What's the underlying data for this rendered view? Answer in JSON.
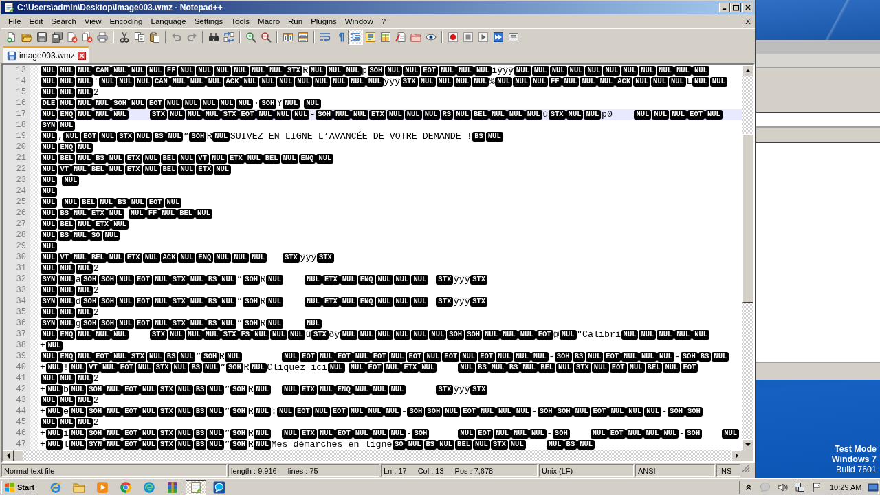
{
  "window": {
    "title": "C:\\Users\\admin\\Desktop\\image003.wmz - Notepad++"
  },
  "menu_bar": {
    "items": [
      "File",
      "Edit",
      "Search",
      "View",
      "Encoding",
      "Language",
      "Settings",
      "Tools",
      "Macro",
      "Run",
      "Plugins",
      "Window",
      "?"
    ],
    "close_label": "X"
  },
  "toolbar": {
    "groups": [
      [
        {
          "pressed": false
        },
        {
          "pressed": false
        },
        {
          "pressed": false
        },
        {
          "pressed": false
        },
        {
          "pressed": false
        },
        {
          "pressed": false
        },
        {
          "pressed": false
        }
      ],
      [
        {
          "pressed": false
        },
        {
          "pressed": false
        },
        {
          "pressed": false
        }
      ],
      [
        {
          "pressed": false
        },
        {
          "pressed": false
        }
      ],
      [
        {
          "pressed": false
        },
        {
          "pressed": false
        }
      ],
      [
        {
          "pressed": false
        },
        {
          "pressed": false
        }
      ],
      [
        {
          "pressed": false
        },
        {
          "pressed": false
        }
      ],
      [
        {
          "pressed": false
        },
        {
          "pressed": false
        },
        {
          "pressed": true
        },
        {
          "pressed": false
        },
        {
          "pressed": false
        },
        {
          "pressed": false
        },
        {
          "pressed": false
        },
        {
          "pressed": false
        }
      ],
      [
        {
          "pressed": false
        },
        {
          "pressed": false
        },
        {
          "pressed": false
        },
        {
          "pressed": false
        },
        {
          "pressed": false
        }
      ]
    ]
  },
  "tabs": [
    {
      "label": "image003.wmz",
      "selected": true,
      "saved": true
    }
  ],
  "editor": {
    "lines": [
      {
        "number": "13",
        "current": false,
        "segments": [
          {
            "kind": "ctrl",
            "codes": [
              "NUL",
              "NUL",
              "NUL",
              "CAN",
              "NUL",
              "NUL",
              "NUL",
              "FF",
              "NUL",
              "NUL",
              "NUL",
              "NUL",
              "NUL",
              "NUL",
              "STX"
            ]
          },
          {
            "kind": "text",
            "text": "R"
          },
          {
            "kind": "ctrl",
            "codes": [
              "NUL",
              "NUL",
              "NUL"
            ]
          },
          {
            "kind": "text",
            "text": "p"
          },
          {
            "kind": "ctrl",
            "codes": [
              "SOH",
              "NUL",
              "NUL",
              "EOT",
              "NUL",
              "NUL",
              "NUL"
            ]
          },
          {
            "kind": "text",
            "text": "iÿÿÿ"
          },
          {
            "kind": "ctrl",
            "codes": [
              "NUL",
              "NUL",
              "NUL",
              "NUL",
              "NUL",
              "NUL",
              "NUL",
              "NUL",
              "NUL",
              "NUL",
              "NUL"
            ]
          }
        ]
      },
      {
        "number": "14",
        "current": false,
        "segments": [
          {
            "kind": "ctrl",
            "codes": [
              "NUL",
              "NUL",
              "NUL"
            ]
          },
          {
            "kind": "text",
            "text": "'"
          },
          {
            "kind": "ctrl",
            "codes": [
              "NUL",
              "NUL",
              "NUL",
              "CAN",
              "NUL",
              "NUL",
              "NUL",
              "ACK",
              "NUL",
              "NUL",
              "NUL",
              "NUL",
              "NUL",
              "NUL",
              "NUL",
              "NUL"
            ]
          },
          {
            "kind": "text",
            "text": "ÿÿÿ"
          },
          {
            "kind": "ctrl",
            "codes": [
              "STX",
              "NUL",
              "NUL",
              "NUL",
              "NUL"
            ]
          },
          {
            "kind": "text",
            "text": "%"
          },
          {
            "kind": "ctrl",
            "codes": [
              "NUL",
              "NUL",
              "NUL",
              "FF",
              "NUL",
              "NUL",
              "NUL",
              "ACK",
              "NUL",
              "NUL",
              "NUL"
            ]
          },
          {
            "kind": "text",
            "text": "L"
          },
          {
            "kind": "ctrl",
            "codes": [
              "NUL",
              "NUL"
            ]
          }
        ]
      },
      {
        "number": "15",
        "current": false,
        "segments": [
          {
            "kind": "ctrl",
            "codes": [
              "NUL",
              "NUL",
              "NUL"
            ]
          },
          {
            "kind": "text",
            "text": "2"
          }
        ]
      },
      {
        "number": "16",
        "current": false,
        "segments": [
          {
            "kind": "ctrl",
            "codes": [
              "DLE",
              "NUL",
              "NUL",
              "NUL",
              "SOH",
              "NUL",
              "EOT",
              "NUL",
              "NUL",
              "NUL",
              "NUL",
              "NUL"
            ]
          },
          {
            "kind": "text",
            "text": "·"
          },
          {
            "kind": "ctrl",
            "codes": [
              "SOH"
            ]
          },
          {
            "kind": "text",
            "text": "Y"
          },
          {
            "kind": "ctrl",
            "codes": [
              "NUL"
            ]
          },
          {
            "kind": "tab"
          },
          {
            "kind": "ctrl",
            "codes": [
              "NUL"
            ]
          }
        ]
      },
      {
        "number": "17",
        "current": true,
        "segments": [
          {
            "kind": "ctrl",
            "codes": [
              "NUL",
              "ENQ",
              "NUL",
              "NUL",
              "NUL"
            ]
          },
          {
            "kind": "tab"
          },
          {
            "kind": "ctrl",
            "codes": [
              "STX",
              "NUL",
              "NUL",
              "NUL"
            ]
          },
          {
            "kind": "caret"
          },
          {
            "kind": "ctrl",
            "codes": [
              "STX",
              "EOT",
              "NUL",
              "NUL",
              "NUL"
            ]
          },
          {
            "kind": "text",
            "text": "-"
          },
          {
            "kind": "ctrl",
            "codes": [
              "SOH",
              "NUL",
              "NUL",
              "ETX",
              "NUL",
              "NUL",
              "NUL",
              "RS",
              "NUL",
              "BEL",
              "NUL",
              "NUL",
              "NUL"
            ]
          },
          {
            "kind": "text",
            "text": "ù"
          },
          {
            "kind": "ctrl",
            "codes": [
              "STX",
              "NUL",
              "NUL"
            ]
          },
          {
            "kind": "text",
            "text": "p0"
          },
          {
            "kind": "tab"
          },
          {
            "kind": "ctrl",
            "codes": [
              "NUL",
              "NUL",
              "NUL",
              "EOT",
              "NUL"
            ]
          }
        ]
      },
      {
        "number": "18",
        "current": false,
        "segments": [
          {
            "kind": "ctrl",
            "codes": [
              "SYN",
              "NUL"
            ]
          }
        ]
      },
      {
        "number": "19",
        "current": false,
        "segments": [
          {
            "kind": "ctrl",
            "codes": [
              "NUL"
            ]
          },
          {
            "kind": "text",
            "text": ","
          },
          {
            "kind": "ctrl",
            "codes": [
              "NUL",
              "EOT",
              "NUL",
              "STX",
              "NUL",
              "BS",
              "NUL"
            ]
          },
          {
            "kind": "text",
            "text": "”"
          },
          {
            "kind": "ctrl",
            "codes": [
              "SOH"
            ]
          },
          {
            "kind": "text",
            "text": "R"
          },
          {
            "kind": "ctrl",
            "codes": [
              "NUL"
            ]
          },
          {
            "kind": "text",
            "text": "SUIVEZ EN LIGNE L’AVANCÉE DE VOTRE DEMANDE !"
          },
          {
            "kind": "ctrl",
            "codes": [
              "BS",
              "NUL"
            ]
          }
        ]
      },
      {
        "number": "20",
        "current": false,
        "segments": [
          {
            "kind": "ctrl",
            "codes": [
              "NUL",
              "ENQ",
              "NUL"
            ]
          }
        ]
      },
      {
        "number": "21",
        "current": false,
        "segments": [
          {
            "kind": "ctrl",
            "codes": [
              "NUL",
              "BEL",
              "NUL",
              "BS",
              "NUL",
              "ETX",
              "NUL",
              "BEL",
              "NUL",
              "VT",
              "NUL",
              "ETX",
              "NUL",
              "BEL",
              "NUL",
              "ENQ",
              "NUL"
            ]
          }
        ]
      },
      {
        "number": "22",
        "current": false,
        "segments": [
          {
            "kind": "ctrl",
            "codes": [
              "NUL",
              "VT",
              "NUL",
              "BEL",
              "NUL",
              "ETX",
              "NUL",
              "BEL",
              "NUL",
              "ETX",
              "NUL"
            ]
          }
        ]
      },
      {
        "number": "23",
        "current": false,
        "segments": [
          {
            "kind": "ctrl",
            "codes": [
              "NUL"
            ]
          },
          {
            "kind": "tab"
          },
          {
            "kind": "ctrl",
            "codes": [
              "NUL"
            ]
          }
        ]
      },
      {
        "number": "24",
        "current": false,
        "segments": [
          {
            "kind": "ctrl",
            "codes": [
              "NUL"
            ]
          }
        ]
      },
      {
        "number": "25",
        "current": false,
        "segments": [
          {
            "kind": "ctrl",
            "codes": [
              "NUL"
            ]
          },
          {
            "kind": "tab"
          },
          {
            "kind": "ctrl",
            "codes": [
              "NUL",
              "BEL",
              "NUL",
              "BS",
              "NUL",
              "EOT",
              "NUL"
            ]
          }
        ]
      },
      {
        "number": "26",
        "current": false,
        "segments": [
          {
            "kind": "ctrl",
            "codes": [
              "NUL",
              "BS",
              "NUL",
              "ETX",
              "NUL"
            ]
          },
          {
            "kind": "tab"
          },
          {
            "kind": "ctrl",
            "codes": [
              "NUL",
              "FF",
              "NUL",
              "BEL",
              "NUL"
            ]
          }
        ]
      },
      {
        "number": "27",
        "current": false,
        "segments": [
          {
            "kind": "ctrl",
            "codes": [
              "NUL",
              "BEL",
              "NUL",
              "ETX",
              "NUL"
            ]
          }
        ]
      },
      {
        "number": "28",
        "current": false,
        "segments": [
          {
            "kind": "ctrl",
            "codes": [
              "NUL",
              "BS",
              "NUL",
              "SO",
              "NUL"
            ]
          }
        ]
      },
      {
        "number": "29",
        "current": false,
        "segments": [
          {
            "kind": "ctrl",
            "codes": [
              "NUL"
            ]
          }
        ]
      },
      {
        "number": "30",
        "current": false,
        "segments": [
          {
            "kind": "ctrl",
            "codes": [
              "NUL",
              "VT",
              "NUL",
              "BEL",
              "NUL",
              "ETX",
              "NUL",
              "ACK",
              "NUL",
              "ENQ",
              "NUL",
              "NUL",
              "NUL"
            ]
          },
          {
            "kind": "tab"
          },
          {
            "kind": "ctrl",
            "codes": [
              "STX"
            ]
          },
          {
            "kind": "text",
            "text": "ÿÿÿ"
          },
          {
            "kind": "ctrl",
            "codes": [
              "STX"
            ]
          }
        ]
      },
      {
        "number": "31",
        "current": false,
        "segments": [
          {
            "kind": "ctrl",
            "codes": [
              "NUL",
              "NUL",
              "NUL"
            ]
          },
          {
            "kind": "text",
            "text": "2"
          }
        ]
      },
      {
        "number": "32",
        "current": false,
        "segments": [
          {
            "kind": "ctrl",
            "codes": [
              "SYN",
              "NUL"
            ]
          },
          {
            "kind": "text",
            "text": "a"
          },
          {
            "kind": "ctrl",
            "codes": [
              "SOH",
              "SOH",
              "NUL",
              "EOT",
              "NUL",
              "STX",
              "NUL",
              "BS",
              "NUL"
            ]
          },
          {
            "kind": "text",
            "text": "”"
          },
          {
            "kind": "ctrl",
            "codes": [
              "SOH"
            ]
          },
          {
            "kind": "text",
            "text": "R"
          },
          {
            "kind": "ctrl",
            "codes": [
              "NUL"
            ]
          },
          {
            "kind": "tab"
          },
          {
            "kind": "ctrl",
            "codes": [
              "NUL",
              "ETX",
              "NUL",
              "ENQ",
              "NUL",
              "NUL",
              "NUL"
            ]
          },
          {
            "kind": "tab"
          },
          {
            "kind": "ctrl",
            "codes": [
              "STX"
            ]
          },
          {
            "kind": "text",
            "text": "ÿÿÿ"
          },
          {
            "kind": "ctrl",
            "codes": [
              "STX"
            ]
          }
        ]
      },
      {
        "number": "33",
        "current": false,
        "segments": [
          {
            "kind": "ctrl",
            "codes": [
              "NUL",
              "NUL",
              "NUL"
            ]
          },
          {
            "kind": "text",
            "text": "2"
          }
        ]
      },
      {
        "number": "34",
        "current": false,
        "segments": [
          {
            "kind": "ctrl",
            "codes": [
              "SYN",
              "NUL"
            ]
          },
          {
            "kind": "text",
            "text": "d"
          },
          {
            "kind": "ctrl",
            "codes": [
              "SOH",
              "SOH",
              "NUL",
              "EOT",
              "NUL",
              "STX",
              "NUL",
              "BS",
              "NUL"
            ]
          },
          {
            "kind": "text",
            "text": "”"
          },
          {
            "kind": "ctrl",
            "codes": [
              "SOH"
            ]
          },
          {
            "kind": "text",
            "text": "R"
          },
          {
            "kind": "ctrl",
            "codes": [
              "NUL"
            ]
          },
          {
            "kind": "tab"
          },
          {
            "kind": "ctrl",
            "codes": [
              "NUL",
              "ETX",
              "NUL",
              "ENQ",
              "NUL",
              "NUL",
              "NUL"
            ]
          },
          {
            "kind": "tab"
          },
          {
            "kind": "ctrl",
            "codes": [
              "STX"
            ]
          },
          {
            "kind": "text",
            "text": "ÿÿÿ"
          },
          {
            "kind": "ctrl",
            "codes": [
              "STX"
            ]
          }
        ]
      },
      {
        "number": "35",
        "current": false,
        "segments": [
          {
            "kind": "ctrl",
            "codes": [
              "NUL",
              "NUL",
              "NUL"
            ]
          },
          {
            "kind": "text",
            "text": "2"
          }
        ]
      },
      {
        "number": "36",
        "current": false,
        "segments": [
          {
            "kind": "ctrl",
            "codes": [
              "SYN",
              "NUL"
            ]
          },
          {
            "kind": "text",
            "text": "g"
          },
          {
            "kind": "ctrl",
            "codes": [
              "SOH",
              "SOH",
              "NUL",
              "EOT",
              "NUL",
              "STX",
              "NUL",
              "BS",
              "NUL"
            ]
          },
          {
            "kind": "text",
            "text": "”"
          },
          {
            "kind": "ctrl",
            "codes": [
              "SOH"
            ]
          },
          {
            "kind": "text",
            "text": "R"
          },
          {
            "kind": "ctrl",
            "codes": [
              "NUL"
            ]
          },
          {
            "kind": "tab"
          },
          {
            "kind": "ctrl",
            "codes": [
              "NUL"
            ]
          }
        ]
      },
      {
        "number": "37",
        "current": false,
        "segments": [
          {
            "kind": "ctrl",
            "codes": [
              "NUL",
              "ENQ",
              "NUL",
              "NUL",
              "NUL"
            ]
          },
          {
            "kind": "tab"
          },
          {
            "kind": "ctrl",
            "codes": [
              "STX",
              "NUL",
              "NUL",
              "NUL",
              "STX",
              "FS",
              "NUL",
              "NUL",
              "NUL"
            ]
          },
          {
            "kind": "text",
            "text": "û"
          },
          {
            "kind": "ctrl",
            "codes": [
              "STX"
            ]
          },
          {
            "kind": "text",
            "text": "ðÿ"
          },
          {
            "kind": "ctrl",
            "codes": [
              "NUL",
              "NUL",
              "NUL",
              "NUL",
              "NUL",
              "NUL",
              "SOH",
              "SOH",
              "NUL",
              "NUL",
              "NUL",
              "EOT"
            ]
          },
          {
            "kind": "text",
            "text": "@"
          },
          {
            "kind": "ctrl",
            "codes": [
              "NUL"
            ]
          },
          {
            "kind": "text",
            "text": "\"Calibri"
          },
          {
            "kind": "ctrl",
            "codes": [
              "NUL",
              "NUL",
              "NUL",
              "NUL",
              "NUL"
            ]
          }
        ]
      },
      {
        "number": "38",
        "current": false,
        "segments": [
          {
            "kind": "text",
            "text": "+"
          },
          {
            "kind": "ctrl",
            "codes": [
              "NUL"
            ]
          }
        ]
      },
      {
        "number": "39",
        "current": false,
        "segments": [
          {
            "kind": "ctrl",
            "codes": [
              "NUL",
              "ENQ",
              "NUL",
              "EOT",
              "NUL",
              "STX",
              "NUL",
              "BS",
              "NUL"
            ]
          },
          {
            "kind": "text",
            "text": "”"
          },
          {
            "kind": "ctrl",
            "codes": [
              "SOH"
            ]
          },
          {
            "kind": "text",
            "text": "R"
          },
          {
            "kind": "ctrl",
            "codes": [
              "NUL"
            ]
          },
          {
            "kind": "tab"
          },
          {
            "kind": "tab"
          },
          {
            "kind": "ctrl",
            "codes": [
              "NUL",
              "EOT",
              "NUL",
              "EOT",
              "NUL",
              "EOT",
              "NUL",
              "EOT",
              "NUL",
              "EOT",
              "NUL",
              "EOT",
              "NUL",
              "NUL",
              "NUL"
            ]
          },
          {
            "kind": "text",
            "text": "-"
          },
          {
            "kind": "ctrl",
            "codes": [
              "SOH",
              "BS",
              "NUL",
              "EOT",
              "NUL",
              "NUL",
              "NUL"
            ]
          },
          {
            "kind": "text",
            "text": "-"
          },
          {
            "kind": "ctrl",
            "codes": [
              "SOH",
              "BS",
              "NUL"
            ]
          }
        ]
      },
      {
        "number": "40",
        "current": false,
        "segments": [
          {
            "kind": "text",
            "text": "+"
          },
          {
            "kind": "ctrl",
            "codes": [
              "NUL"
            ]
          },
          {
            "kind": "text",
            "text": "!"
          },
          {
            "kind": "ctrl",
            "codes": [
              "NUL",
              "VT",
              "NUL",
              "EOT",
              "NUL",
              "STX",
              "NUL",
              "BS",
              "NUL"
            ]
          },
          {
            "kind": "text",
            "text": "”"
          },
          {
            "kind": "ctrl",
            "codes": [
              "SOH"
            ]
          },
          {
            "kind": "text",
            "text": "R"
          },
          {
            "kind": "ctrl",
            "codes": [
              "NUL"
            ]
          },
          {
            "kind": "text",
            "text": "Cliquez ici"
          },
          {
            "kind": "ctrl",
            "codes": [
              "NUL"
            ]
          },
          {
            "kind": "tab"
          },
          {
            "kind": "ctrl",
            "codes": [
              "NUL",
              "EOT",
              "NUL",
              "ETX",
              "NUL"
            ]
          },
          {
            "kind": "tab"
          },
          {
            "kind": "ctrl",
            "codes": [
              "NUL",
              "BS",
              "NUL",
              "BS",
              "NUL",
              "BEL",
              "NUL",
              "STX",
              "NUL",
              "EOT",
              "NUL",
              "BEL",
              "NUL",
              "EOT"
            ]
          }
        ]
      },
      {
        "number": "41",
        "current": false,
        "segments": [
          {
            "kind": "ctrl",
            "codes": [
              "NUL",
              "NUL",
              "NUL"
            ]
          },
          {
            "kind": "text",
            "text": "2"
          }
        ]
      },
      {
        "number": "42",
        "current": false,
        "segments": [
          {
            "kind": "text",
            "text": "+"
          },
          {
            "kind": "ctrl",
            "codes": [
              "NUL"
            ]
          },
          {
            "kind": "text",
            "text": "b"
          },
          {
            "kind": "ctrl",
            "codes": [
              "NUL",
              "SOH",
              "NUL",
              "EOT",
              "NUL",
              "STX",
              "NUL",
              "BS",
              "NUL"
            ]
          },
          {
            "kind": "text",
            "text": "”"
          },
          {
            "kind": "ctrl",
            "codes": [
              "SOH"
            ]
          },
          {
            "kind": "text",
            "text": "R"
          },
          {
            "kind": "ctrl",
            "codes": [
              "NUL"
            ]
          },
          {
            "kind": "tab"
          },
          {
            "kind": "ctrl",
            "codes": [
              "NUL",
              "ETX",
              "NUL",
              "ENQ",
              "NUL",
              "NUL",
              "NUL"
            ]
          },
          {
            "kind": "tab"
          },
          {
            "kind": "tab"
          },
          {
            "kind": "ctrl",
            "codes": [
              "STX"
            ]
          },
          {
            "kind": "text",
            "text": "ÿÿÿ"
          },
          {
            "kind": "ctrl",
            "codes": [
              "STX"
            ]
          }
        ]
      },
      {
        "number": "43",
        "current": false,
        "segments": [
          {
            "kind": "ctrl",
            "codes": [
              "NUL",
              "NUL",
              "NUL"
            ]
          },
          {
            "kind": "text",
            "text": "2"
          }
        ]
      },
      {
        "number": "44",
        "current": false,
        "segments": [
          {
            "kind": "text",
            "text": "+"
          },
          {
            "kind": "ctrl",
            "codes": [
              "NUL"
            ]
          },
          {
            "kind": "text",
            "text": "e"
          },
          {
            "kind": "ctrl",
            "codes": [
              "NUL",
              "SOH",
              "NUL",
              "EOT",
              "NUL",
              "STX",
              "NUL",
              "BS",
              "NUL"
            ]
          },
          {
            "kind": "text",
            "text": "”"
          },
          {
            "kind": "ctrl",
            "codes": [
              "SOH"
            ]
          },
          {
            "kind": "text",
            "text": "R"
          },
          {
            "kind": "ctrl",
            "codes": [
              "NUL"
            ]
          },
          {
            "kind": "text",
            "text": ":"
          },
          {
            "kind": "ctrl",
            "codes": [
              "NUL",
              "EOT",
              "NUL",
              "EOT",
              "NUL",
              "NUL",
              "NUL"
            ]
          },
          {
            "kind": "text",
            "text": "-"
          },
          {
            "kind": "ctrl",
            "codes": [
              "SOH",
              "SOH",
              "NUL",
              "EOT",
              "NUL",
              "NUL",
              "NUL"
            ]
          },
          {
            "kind": "text",
            "text": "-"
          },
          {
            "kind": "ctrl",
            "codes": [
              "SOH",
              "SOH",
              "NUL",
              "EOT",
              "NUL",
              "NUL",
              "NUL"
            ]
          },
          {
            "kind": "text",
            "text": "-"
          },
          {
            "kind": "ctrl",
            "codes": [
              "SOH",
              "SOH"
            ]
          }
        ]
      },
      {
        "number": "45",
        "current": false,
        "segments": [
          {
            "kind": "ctrl",
            "codes": [
              "NUL",
              "NUL",
              "NUL"
            ]
          },
          {
            "kind": "text",
            "text": "2"
          }
        ]
      },
      {
        "number": "46",
        "current": false,
        "segments": [
          {
            "kind": "text",
            "text": "+"
          },
          {
            "kind": "ctrl",
            "codes": [
              "NUL"
            ]
          },
          {
            "kind": "text",
            "text": "i"
          },
          {
            "kind": "ctrl",
            "codes": [
              "NUL",
              "SOH",
              "NUL",
              "EOT",
              "NUL",
              "STX",
              "NUL",
              "BS",
              "NUL"
            ]
          },
          {
            "kind": "text",
            "text": "”"
          },
          {
            "kind": "ctrl",
            "codes": [
              "SOH"
            ]
          },
          {
            "kind": "text",
            "text": "R"
          },
          {
            "kind": "ctrl",
            "codes": [
              "NUL"
            ]
          },
          {
            "kind": "tab"
          },
          {
            "kind": "ctrl",
            "codes": [
              "NUL",
              "ETX",
              "NUL",
              "EOT",
              "NUL",
              "NUL",
              "NUL"
            ]
          },
          {
            "kind": "text",
            "text": "-"
          },
          {
            "kind": "ctrl",
            "codes": [
              "SOH"
            ]
          },
          {
            "kind": "tab"
          },
          {
            "kind": "tab"
          },
          {
            "kind": "ctrl",
            "codes": [
              "NUL",
              "EOT",
              "NUL",
              "NUL",
              "NUL"
            ]
          },
          {
            "kind": "text",
            "text": "-"
          },
          {
            "kind": "ctrl",
            "codes": [
              "SOH"
            ]
          },
          {
            "kind": "tab"
          },
          {
            "kind": "ctrl",
            "codes": [
              "NUL",
              "EOT",
              "NUL",
              "NUL",
              "NUL"
            ]
          },
          {
            "kind": "text",
            "text": "-"
          },
          {
            "kind": "ctrl",
            "codes": [
              "SOH"
            ]
          },
          {
            "kind": "tab"
          },
          {
            "kind": "ctrl",
            "codes": [
              "NUL"
            ]
          }
        ]
      },
      {
        "number": "47",
        "current": false,
        "segments": [
          {
            "kind": "text",
            "text": "+"
          },
          {
            "kind": "ctrl",
            "codes": [
              "NUL"
            ]
          },
          {
            "kind": "text",
            "text": "l"
          },
          {
            "kind": "ctrl",
            "codes": [
              "NUL",
              "SYN",
              "NUL",
              "EOT",
              "NUL",
              "STX",
              "NUL",
              "BS",
              "NUL"
            ]
          },
          {
            "kind": "text",
            "text": "”"
          },
          {
            "kind": "ctrl",
            "codes": [
              "SOH"
            ]
          },
          {
            "kind": "text",
            "text": "R"
          },
          {
            "kind": "ctrl",
            "codes": [
              "NUL"
            ]
          },
          {
            "kind": "text",
            "text": "Mes démarches en ligne"
          },
          {
            "kind": "ctrl",
            "codes": [
              "SO",
              "NUL",
              "BS",
              "NUL",
              "BEL",
              "NUL",
              "STX",
              "NUL"
            ]
          },
          {
            "kind": "tab"
          },
          {
            "kind": "ctrl",
            "codes": [
              "NUL",
              "BS",
              "NUL"
            ]
          }
        ]
      }
    ]
  },
  "status_bar": {
    "sections": [
      [
        "Normal text file"
      ],
      [
        "length : 9,916",
        "lines : 75"
      ],
      [
        "Ln : 17",
        "Col : 13",
        "Pos : 7,678"
      ],
      [
        "Unix (LF)"
      ],
      [
        "ANSI"
      ],
      [
        "INS"
      ]
    ]
  },
  "taskbar": {
    "start": "Start",
    "apps": [
      {
        "selected": false
      },
      {
        "selected": false
      },
      {
        "selected": false
      },
      {
        "selected": false
      },
      {
        "selected": false
      },
      {
        "selected": false
      },
      {
        "selected": true
      },
      {
        "selected": false
      }
    ],
    "clock": "10:29 AM"
  },
  "desktop": {
    "notice": [
      {
        "text": "Test Mode",
        "bold": true
      },
      {
        "text": "Windows 7",
        "bold": true
      },
      {
        "text": "Build 7601",
        "bold": false
      }
    ]
  }
}
